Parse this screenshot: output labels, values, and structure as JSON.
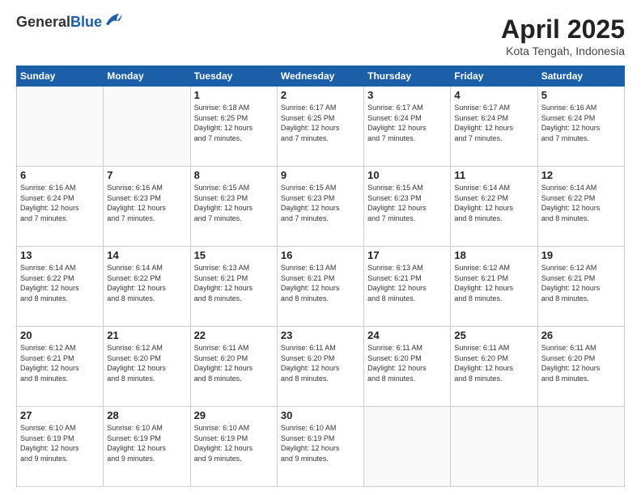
{
  "header": {
    "logo_general": "General",
    "logo_blue": "Blue",
    "month": "April 2025",
    "location": "Kota Tengah, Indonesia"
  },
  "weekdays": [
    "Sunday",
    "Monday",
    "Tuesday",
    "Wednesday",
    "Thursday",
    "Friday",
    "Saturday"
  ],
  "weeks": [
    [
      {
        "day": "",
        "info": ""
      },
      {
        "day": "",
        "info": ""
      },
      {
        "day": "1",
        "info": "Sunrise: 6:18 AM\nSunset: 6:25 PM\nDaylight: 12 hours\nand 7 minutes."
      },
      {
        "day": "2",
        "info": "Sunrise: 6:17 AM\nSunset: 6:25 PM\nDaylight: 12 hours\nand 7 minutes."
      },
      {
        "day": "3",
        "info": "Sunrise: 6:17 AM\nSunset: 6:24 PM\nDaylight: 12 hours\nand 7 minutes."
      },
      {
        "day": "4",
        "info": "Sunrise: 6:17 AM\nSunset: 6:24 PM\nDaylight: 12 hours\nand 7 minutes."
      },
      {
        "day": "5",
        "info": "Sunrise: 6:16 AM\nSunset: 6:24 PM\nDaylight: 12 hours\nand 7 minutes."
      }
    ],
    [
      {
        "day": "6",
        "info": "Sunrise: 6:16 AM\nSunset: 6:24 PM\nDaylight: 12 hours\nand 7 minutes."
      },
      {
        "day": "7",
        "info": "Sunrise: 6:16 AM\nSunset: 6:23 PM\nDaylight: 12 hours\nand 7 minutes."
      },
      {
        "day": "8",
        "info": "Sunrise: 6:15 AM\nSunset: 6:23 PM\nDaylight: 12 hours\nand 7 minutes."
      },
      {
        "day": "9",
        "info": "Sunrise: 6:15 AM\nSunset: 6:23 PM\nDaylight: 12 hours\nand 7 minutes."
      },
      {
        "day": "10",
        "info": "Sunrise: 6:15 AM\nSunset: 6:23 PM\nDaylight: 12 hours\nand 7 minutes."
      },
      {
        "day": "11",
        "info": "Sunrise: 6:14 AM\nSunset: 6:22 PM\nDaylight: 12 hours\nand 8 minutes."
      },
      {
        "day": "12",
        "info": "Sunrise: 6:14 AM\nSunset: 6:22 PM\nDaylight: 12 hours\nand 8 minutes."
      }
    ],
    [
      {
        "day": "13",
        "info": "Sunrise: 6:14 AM\nSunset: 6:22 PM\nDaylight: 12 hours\nand 8 minutes."
      },
      {
        "day": "14",
        "info": "Sunrise: 6:14 AM\nSunset: 6:22 PM\nDaylight: 12 hours\nand 8 minutes."
      },
      {
        "day": "15",
        "info": "Sunrise: 6:13 AM\nSunset: 6:21 PM\nDaylight: 12 hours\nand 8 minutes."
      },
      {
        "day": "16",
        "info": "Sunrise: 6:13 AM\nSunset: 6:21 PM\nDaylight: 12 hours\nand 8 minutes."
      },
      {
        "day": "17",
        "info": "Sunrise: 6:13 AM\nSunset: 6:21 PM\nDaylight: 12 hours\nand 8 minutes."
      },
      {
        "day": "18",
        "info": "Sunrise: 6:12 AM\nSunset: 6:21 PM\nDaylight: 12 hours\nand 8 minutes."
      },
      {
        "day": "19",
        "info": "Sunrise: 6:12 AM\nSunset: 6:21 PM\nDaylight: 12 hours\nand 8 minutes."
      }
    ],
    [
      {
        "day": "20",
        "info": "Sunrise: 6:12 AM\nSunset: 6:21 PM\nDaylight: 12 hours\nand 8 minutes."
      },
      {
        "day": "21",
        "info": "Sunrise: 6:12 AM\nSunset: 6:20 PM\nDaylight: 12 hours\nand 8 minutes."
      },
      {
        "day": "22",
        "info": "Sunrise: 6:11 AM\nSunset: 6:20 PM\nDaylight: 12 hours\nand 8 minutes."
      },
      {
        "day": "23",
        "info": "Sunrise: 6:11 AM\nSunset: 6:20 PM\nDaylight: 12 hours\nand 8 minutes."
      },
      {
        "day": "24",
        "info": "Sunrise: 6:11 AM\nSunset: 6:20 PM\nDaylight: 12 hours\nand 8 minutes."
      },
      {
        "day": "25",
        "info": "Sunrise: 6:11 AM\nSunset: 6:20 PM\nDaylight: 12 hours\nand 8 minutes."
      },
      {
        "day": "26",
        "info": "Sunrise: 6:11 AM\nSunset: 6:20 PM\nDaylight: 12 hours\nand 8 minutes."
      }
    ],
    [
      {
        "day": "27",
        "info": "Sunrise: 6:10 AM\nSunset: 6:19 PM\nDaylight: 12 hours\nand 9 minutes."
      },
      {
        "day": "28",
        "info": "Sunrise: 6:10 AM\nSunset: 6:19 PM\nDaylight: 12 hours\nand 9 minutes."
      },
      {
        "day": "29",
        "info": "Sunrise: 6:10 AM\nSunset: 6:19 PM\nDaylight: 12 hours\nand 9 minutes."
      },
      {
        "day": "30",
        "info": "Sunrise: 6:10 AM\nSunset: 6:19 PM\nDaylight: 12 hours\nand 9 minutes."
      },
      {
        "day": "",
        "info": ""
      },
      {
        "day": "",
        "info": ""
      },
      {
        "day": "",
        "info": ""
      }
    ]
  ]
}
